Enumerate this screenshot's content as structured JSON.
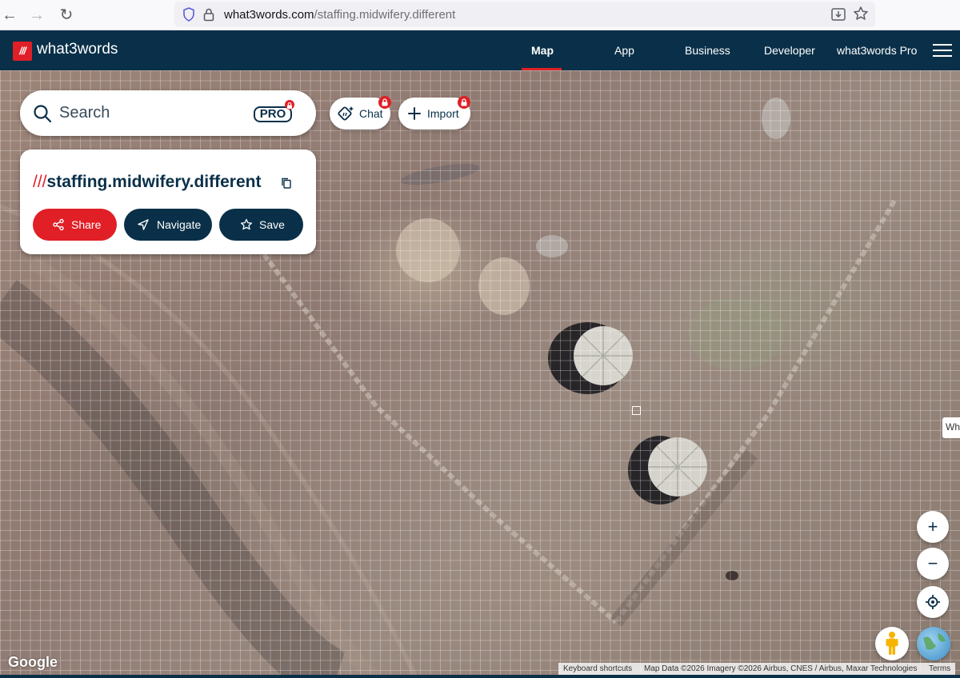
{
  "browser": {
    "url_domain": "what3words.com",
    "url_path": "/staffing.midwifery.different"
  },
  "header": {
    "logo_mark": "///",
    "logo_text": "what3words",
    "nav": [
      "Map",
      "App",
      "Business",
      "Developer",
      "what3words Pro"
    ],
    "active_nav": "Map"
  },
  "search": {
    "placeholder": "Search",
    "pro_badge": "PRO"
  },
  "toolbar": {
    "chat_label": "Chat",
    "import_label": "Import"
  },
  "address": {
    "slashes": "///",
    "words": "staffing.midwifery.different"
  },
  "actions": {
    "share": "Share",
    "navigate": "Navigate",
    "save": "Save"
  },
  "map": {
    "type": "satellite",
    "google_logo": "Google",
    "attribution": [
      "Keyboard shortcuts",
      "Map Data ©2026 Imagery ©2026 Airbus, CNES / Airbus, Maxar Technologies",
      "Terms"
    ],
    "side_tab": "Wh",
    "zoom_in": "+",
    "zoom_out": "−"
  },
  "colors": {
    "brand_red": "#e11f26",
    "brand_navy": "#0a3049"
  }
}
